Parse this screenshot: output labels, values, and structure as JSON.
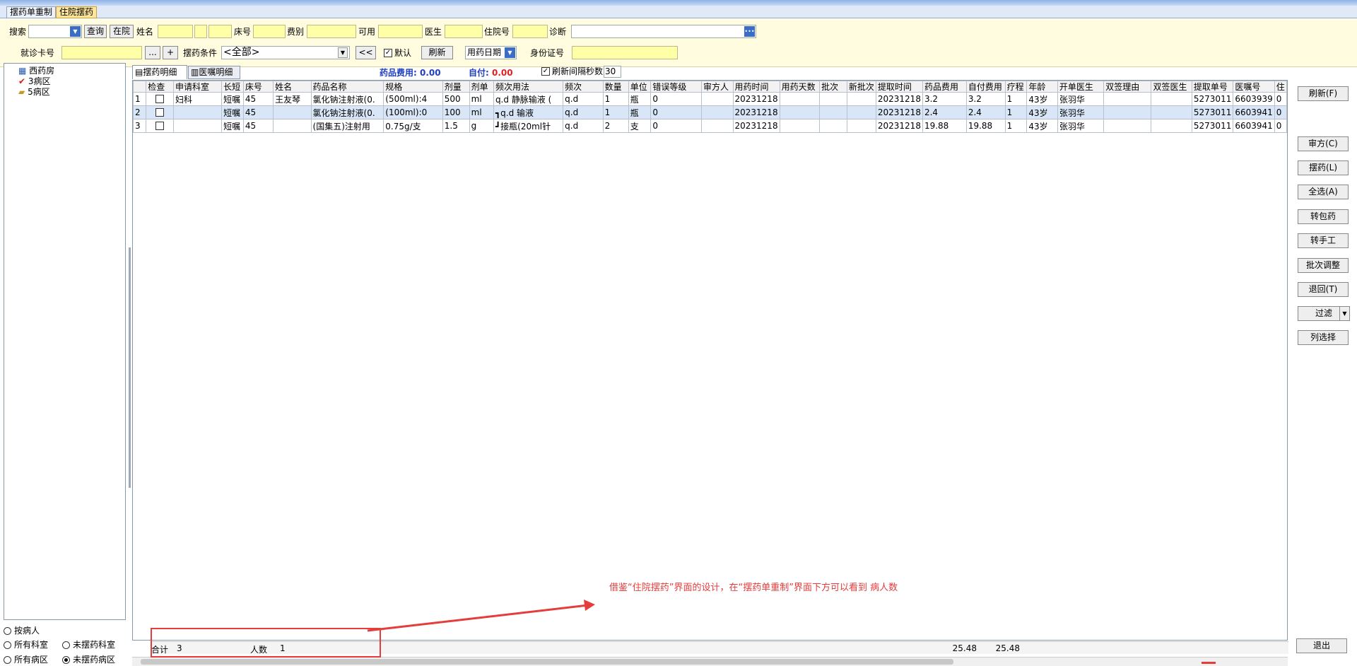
{
  "tabs": [
    "摆药单重制",
    "住院摆药"
  ],
  "filters": {
    "search_label": "搜索",
    "query_btn": "查询",
    "inhospital_btn": "在院",
    "name_label": "姓名",
    "bed_label": "床号",
    "fee_type_label": "费别",
    "available_label": "可用",
    "doctor_label": "医生",
    "admission_label": "住院号",
    "diagnosis_label": "诊断",
    "visit_card_label": "就诊卡号",
    "ellipsis_btn": "...",
    "plus_btn": "+",
    "condition_label": "摆药条件",
    "condition_value": "<全部>",
    "prev_btn": "<<",
    "default_label": "默认",
    "refresh_btn": "刷新",
    "date_mode": "用药日期",
    "id_label": "身份证号"
  },
  "subtabs": [
    "摆药明细",
    "医嘱明细"
  ],
  "summary": {
    "drug_fee_label": "药品费用:",
    "drug_fee": "0.00",
    "self_pay_label": "自付:",
    "self_pay": "0.00",
    "refresh_interval_label": "刷新间隔秒数",
    "refresh_interval": "30"
  },
  "tree": [
    "西药房",
    "3病区",
    "5病区"
  ],
  "columns": [
    "检查",
    "申请科室",
    "长短",
    "床号",
    "姓名",
    "药品名称",
    "规格",
    "剂量",
    "剂单",
    "频次用法",
    "频次",
    "数量",
    "单位",
    "错误等级",
    "审方人",
    "用药时间",
    "用药天数",
    "批次",
    "新批次",
    "提取时间",
    "药品费用",
    "自付费用",
    "疗程",
    "年龄",
    "开单医生",
    "双签理由",
    "双签医生",
    "提取单号",
    "医嘱号",
    "住"
  ],
  "rows": [
    [
      "1",
      "",
      "妇科",
      "短嘱",
      "45",
      "王友琴",
      "氯化钠注射液(0.",
      "(500ml):4",
      "500",
      "ml",
      "q.d 静脉输液 (",
      "q.d",
      "1",
      "瓶",
      "0",
      "",
      "20231218",
      "",
      "",
      "",
      "20231218",
      "3.2",
      "3.2",
      "1",
      "43岁",
      "张羽华",
      "",
      "",
      "5273011",
      "6603939",
      "0"
    ],
    [
      "2",
      "",
      "",
      "短嘱",
      "45",
      "",
      "氯化钠注射液(0.",
      "(100ml):0",
      "100",
      "ml",
      "┓q.d 输液",
      "q.d",
      "1",
      "瓶",
      "0",
      "",
      "20231218",
      "",
      "",
      "",
      "20231218",
      "2.4",
      "2.4",
      "1",
      "43岁",
      "张羽华",
      "",
      "",
      "5273011",
      "6603941",
      "0"
    ],
    [
      "3",
      "",
      "",
      "短嘱",
      "45",
      "",
      "(国集五)注射用",
      "0.75g/支",
      "1.5",
      "g",
      "┛接瓶(20ml针",
      "q.d",
      "2",
      "支",
      "0",
      "",
      "20231218",
      "",
      "",
      "",
      "20231218",
      "19.88",
      "19.88",
      "1",
      "43岁",
      "张羽华",
      "",
      "",
      "5273011",
      "6603941",
      "0"
    ]
  ],
  "right_buttons": [
    "刷新(F)",
    "审方(C)",
    "摆药(L)",
    "全选(A)",
    "转包药",
    "转手工",
    "批次调整",
    "退回(T)",
    "过滤",
    "列选择"
  ],
  "exit_btn": "退出",
  "radios": {
    "by_patient": "按病人",
    "all_dept": "所有科室",
    "not_dept": "未摆药科室",
    "all_ward": "所有病区",
    "not_ward": "未摆药病区"
  },
  "footer": {
    "total_label": "合计",
    "total": "3",
    "people_label": "人数",
    "people": "1",
    "sum1": "25.48",
    "sum2": "25.48"
  },
  "annotation": "借鉴“住院摆药”界面的设计，在“摆药单重制”界面下方可以看到 病人数",
  "colors": {
    "accent": "#e53c3c",
    "input_bg": "#ffffa8",
    "blue": "#1f3fbf"
  }
}
